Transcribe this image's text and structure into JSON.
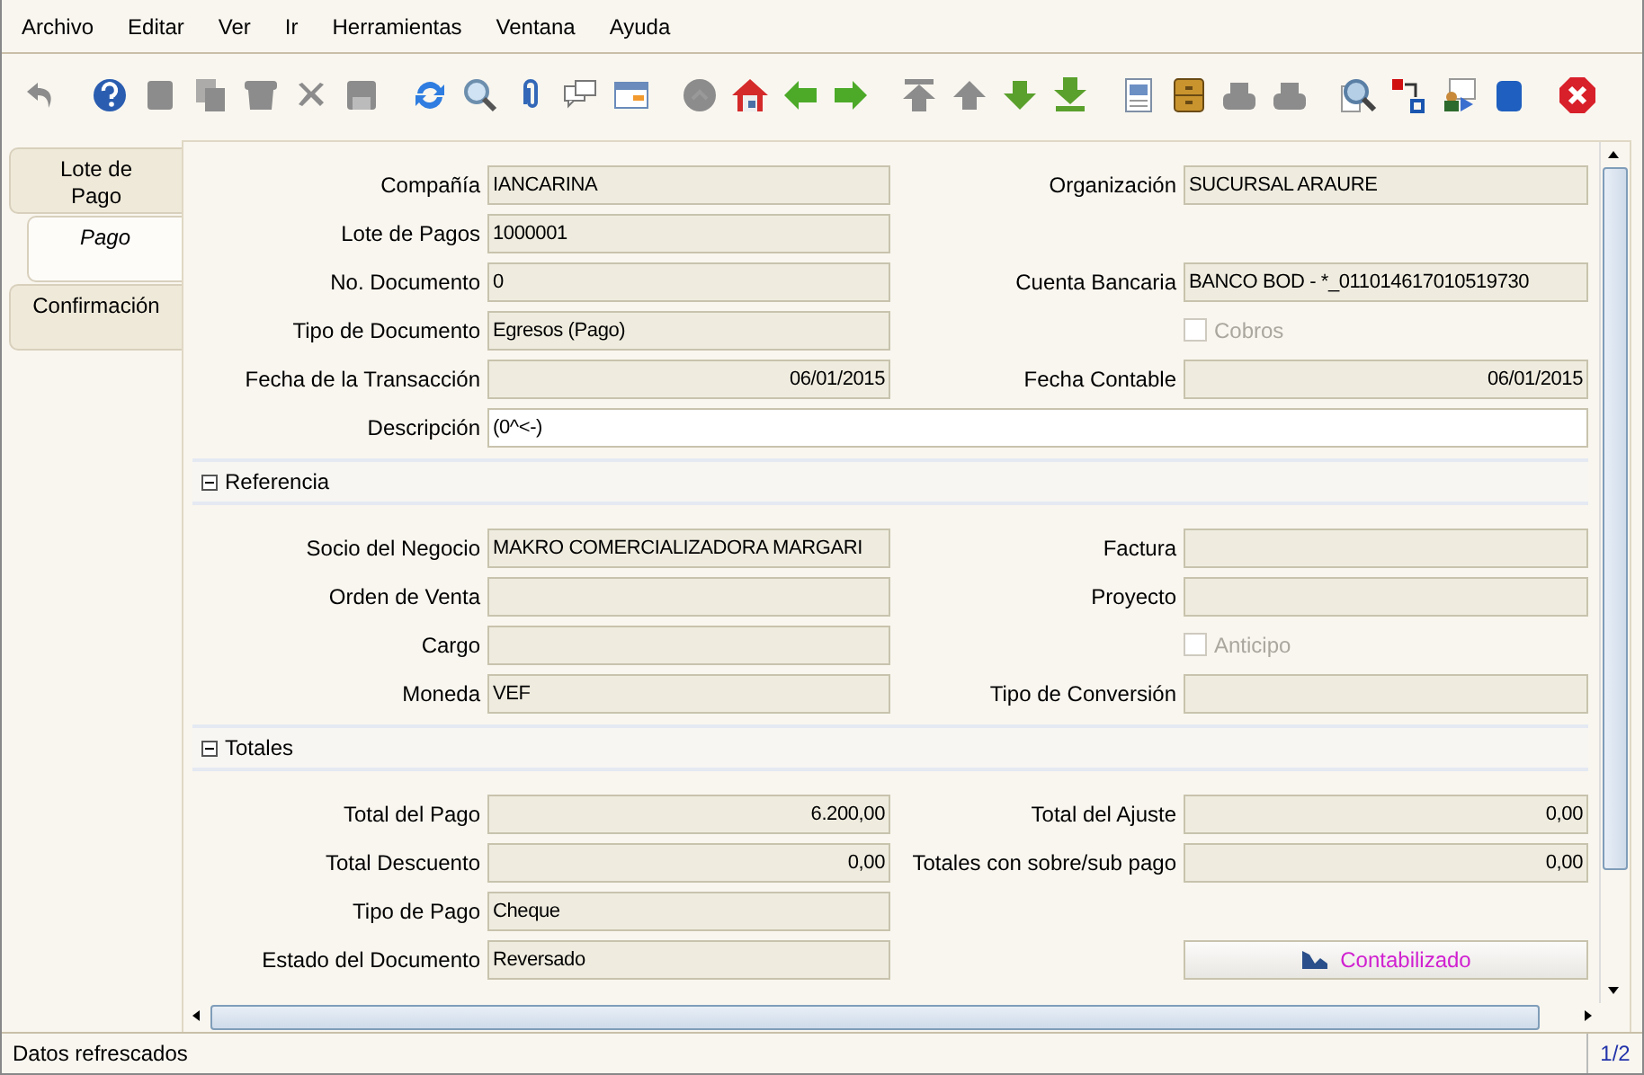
{
  "menu": [
    "Archivo",
    "Editar",
    "Ver",
    "Ir",
    "Herramientas",
    "Ventana",
    "Ayuda"
  ],
  "toolbar": [
    {
      "kind": "undo",
      "disabled": true
    },
    {
      "kind": "separator"
    },
    {
      "kind": "help",
      "disabled": false
    },
    {
      "kind": "new",
      "disabled": true
    },
    {
      "kind": "copy",
      "disabled": true
    },
    {
      "kind": "delete",
      "disabled": true
    },
    {
      "kind": "remove",
      "disabled": true
    },
    {
      "kind": "save",
      "disabled": true
    },
    {
      "kind": "separator"
    },
    {
      "kind": "refresh",
      "disabled": false
    },
    {
      "kind": "find",
      "disabled": false
    },
    {
      "kind": "attach",
      "disabled": false
    },
    {
      "kind": "chat",
      "disabled": false
    },
    {
      "kind": "grid",
      "disabled": false
    },
    {
      "kind": "separator"
    },
    {
      "kind": "history",
      "disabled": true
    },
    {
      "kind": "home",
      "disabled": false
    },
    {
      "kind": "back",
      "disabled": false
    },
    {
      "kind": "forward",
      "disabled": false
    },
    {
      "kind": "separator"
    },
    {
      "kind": "first",
      "disabled": true
    },
    {
      "kind": "previous",
      "disabled": true
    },
    {
      "kind": "next",
      "disabled": false
    },
    {
      "kind": "last",
      "disabled": false
    },
    {
      "kind": "separator"
    },
    {
      "kind": "report",
      "disabled": false
    },
    {
      "kind": "archive",
      "disabled": false
    },
    {
      "kind": "preview",
      "disabled": true
    },
    {
      "kind": "print",
      "disabled": true
    },
    {
      "kind": "separator"
    },
    {
      "kind": "zoom",
      "disabled": false
    },
    {
      "kind": "workflow",
      "disabled": false
    },
    {
      "kind": "request",
      "disabled": false
    },
    {
      "kind": "product",
      "disabled": false
    },
    {
      "kind": "separator"
    },
    {
      "kind": "exit",
      "disabled": false
    }
  ],
  "tabs": [
    {
      "label": "Lote de Pago",
      "selected": false
    },
    {
      "label": "Pago",
      "selected": true
    },
    {
      "label": "Confirmación",
      "selected": false
    }
  ],
  "sections": [
    {
      "rows": [
        {
          "left": {
            "kind": "text",
            "label": "Compañía",
            "value": "IANCARINA",
            "readonly": true
          },
          "right": {
            "kind": "text",
            "label": "Organización",
            "value": "SUCURSAL ARAURE",
            "readonly": true
          }
        },
        {
          "left": {
            "kind": "text",
            "label": "Lote de Pagos",
            "value": "1000001",
            "readonly": true
          }
        },
        {
          "left": {
            "kind": "text",
            "label": "No. Documento",
            "value": "0",
            "readonly": true
          },
          "right": {
            "kind": "text",
            "label": "Cuenta Bancaria",
            "value": "BANCO BOD - *_011014617010519730",
            "readonly": true
          }
        },
        {
          "left": {
            "kind": "text",
            "label": "Tipo de Documento",
            "value": "Egresos (Pago)",
            "readonly": true
          },
          "right": {
            "kind": "checkbox",
            "label": "Cobros",
            "checked": false,
            "disabled": true
          }
        },
        {
          "left": {
            "kind": "number",
            "label": "Fecha de la Transacción",
            "value": "06/01/2015",
            "readonly": true
          },
          "right": {
            "kind": "number",
            "label": "Fecha Contable",
            "value": "06/01/2015",
            "readonly": true
          }
        },
        {
          "wide": {
            "kind": "text",
            "label": "Descripción",
            "value": "(0^<-)",
            "readonly": false
          }
        }
      ]
    },
    {
      "title": "Referencia",
      "expanded": true,
      "rows": [
        {
          "left": {
            "kind": "text",
            "label": "Socio del Negocio",
            "value": "MAKRO COMERCIALIZADORA MARGARI",
            "readonly": true
          },
          "right": {
            "kind": "text",
            "label": "Factura",
            "readonly": true
          }
        },
        {
          "left": {
            "kind": "text",
            "label": "Orden de Venta",
            "readonly": true
          },
          "right": {
            "kind": "text",
            "label": "Proyecto",
            "readonly": true
          }
        },
        {
          "left": {
            "kind": "text",
            "label": "Cargo",
            "readonly": true
          },
          "right": {
            "kind": "checkbox",
            "label": "Anticipo",
            "checked": false,
            "disabled": true
          }
        },
        {
          "left": {
            "kind": "text",
            "label": "Moneda",
            "value": "VEF",
            "readonly": true
          },
          "right": {
            "kind": "text",
            "label": "Tipo de Conversión",
            "readonly": true
          }
        }
      ]
    },
    {
      "title": "Totales",
      "expanded": true,
      "rows": [
        {
          "left": {
            "kind": "number",
            "label": "Total del Pago",
            "value": "6.200,00",
            "readonly": true
          },
          "right": {
            "kind": "number",
            "label": "Total del Ajuste",
            "value": "0,00",
            "readonly": true
          }
        },
        {
          "left": {
            "kind": "number",
            "label": "Total Descuento",
            "value": "0,00",
            "readonly": true
          },
          "right": {
            "kind": "number",
            "label": "Totales con sobre/sub pago",
            "value": "0,00",
            "readonly": true
          }
        },
        {
          "left": {
            "kind": "text",
            "label": "Tipo de Pago",
            "value": "Cheque",
            "readonly": true
          }
        },
        {
          "left": {
            "kind": "text",
            "label": "Estado del Documento",
            "value": "Reversado",
            "readonly": true
          },
          "right": {
            "kind": "button",
            "value": "Contabilizado"
          }
        }
      ]
    }
  ],
  "status_bar": {
    "message": "Datos refrescados",
    "record": "1/2"
  }
}
